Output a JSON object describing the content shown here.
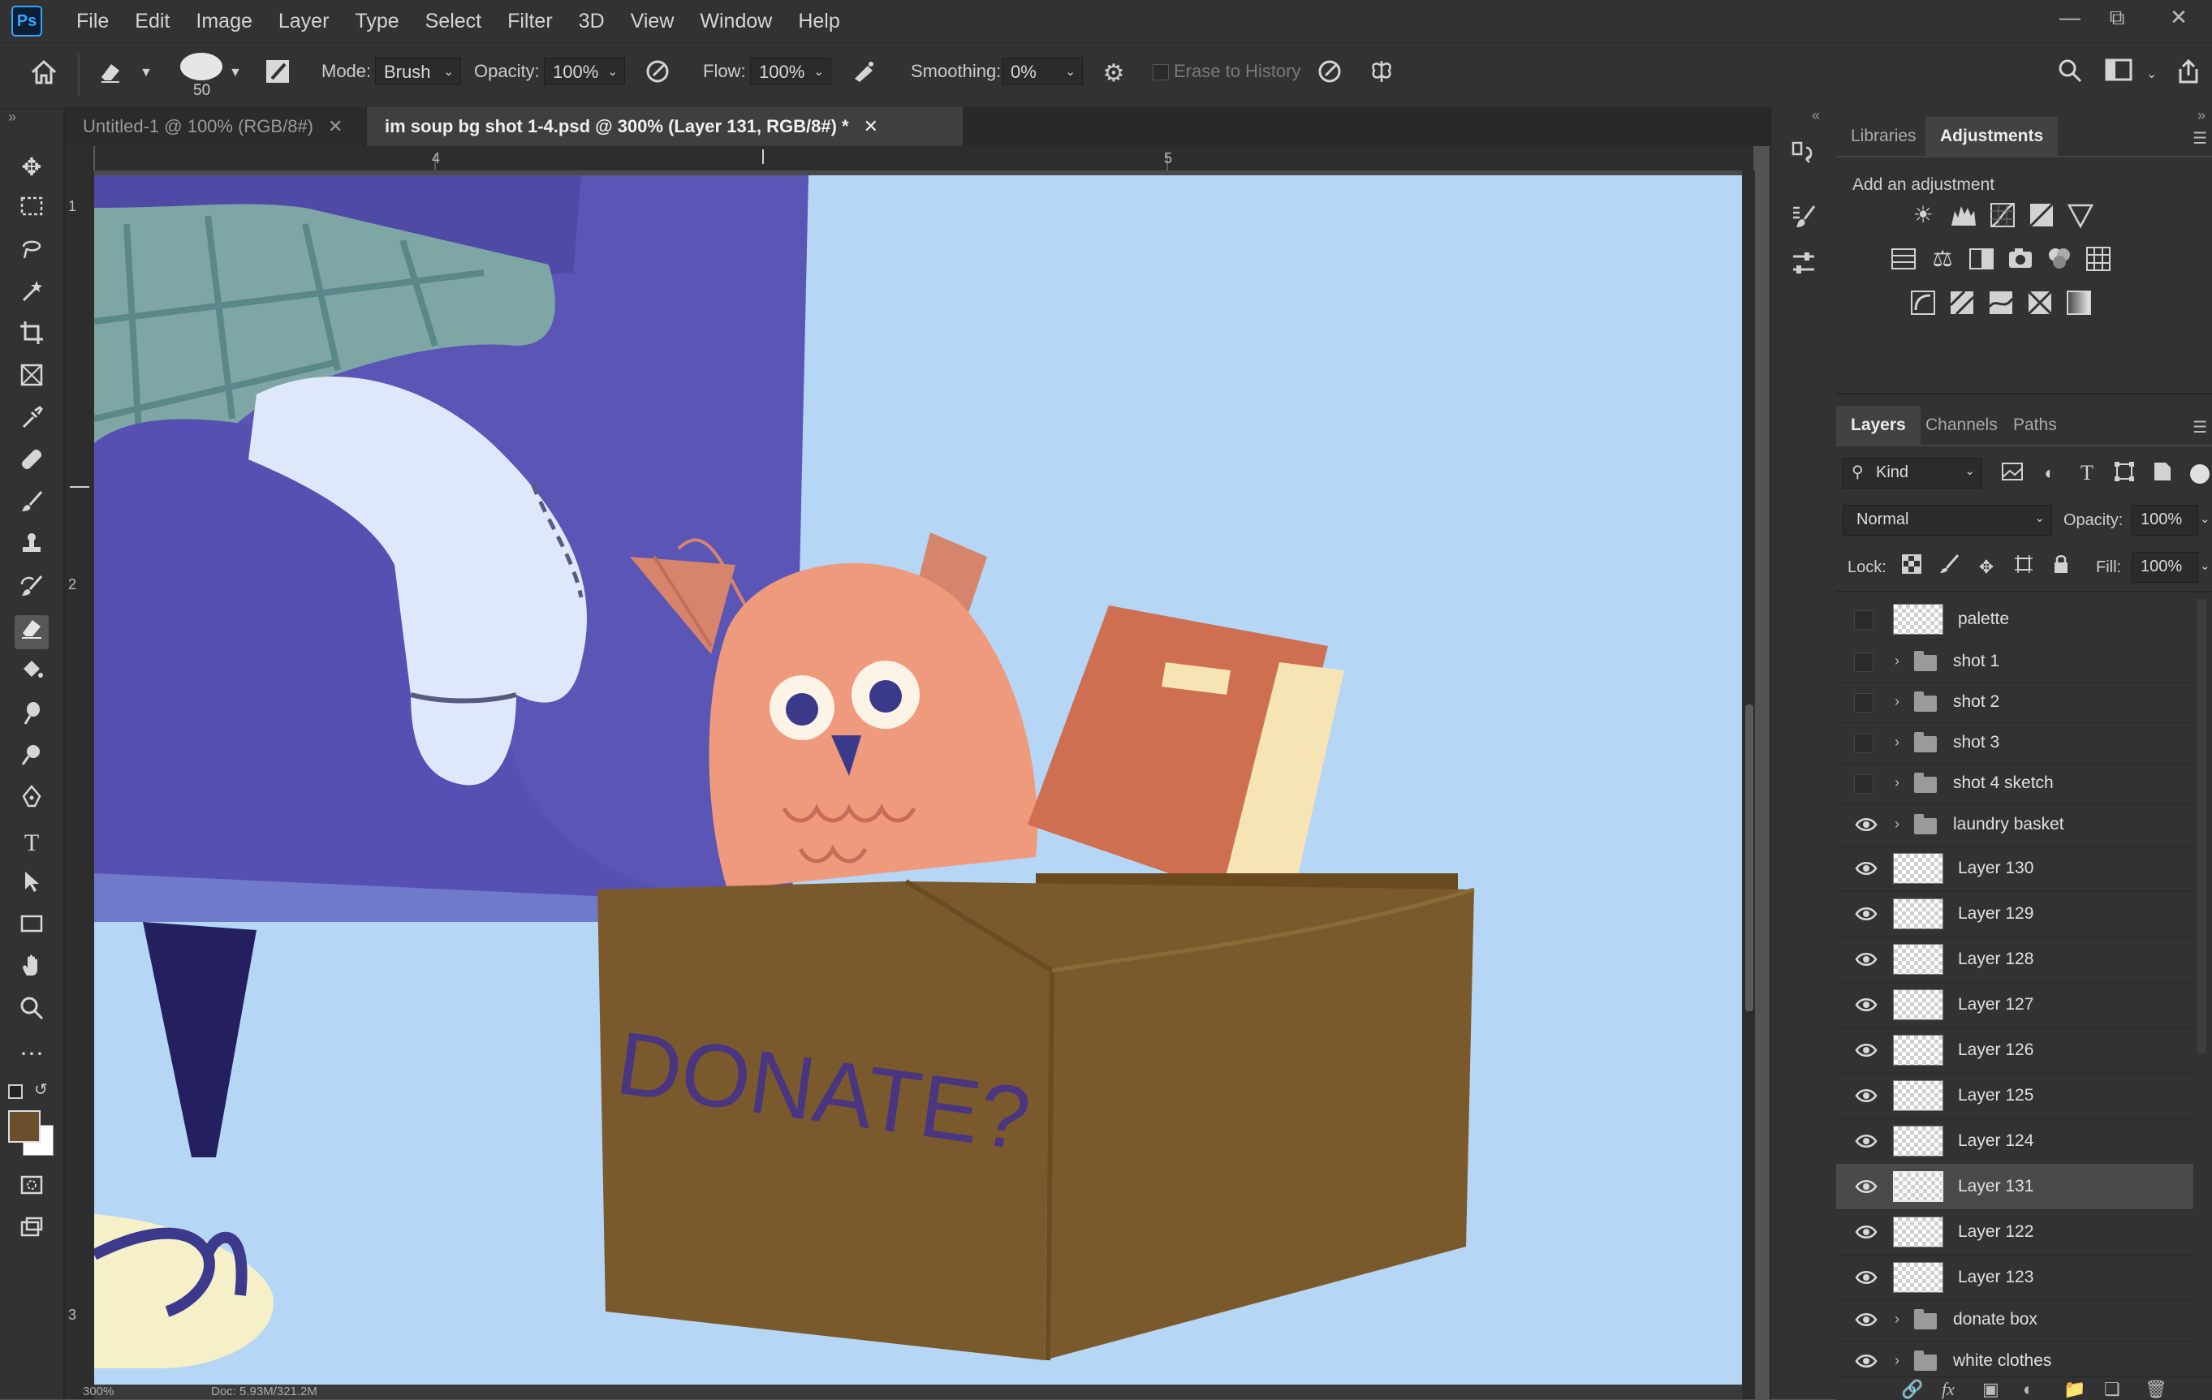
{
  "app": {
    "logo": "Ps",
    "menu": [
      "File",
      "Edit",
      "Image",
      "Layer",
      "Type",
      "Select",
      "Filter",
      "3D",
      "View",
      "Window",
      "Help"
    ]
  },
  "options": {
    "brush_size": "50",
    "mode_label": "Mode:",
    "mode_value": "Brush",
    "opacity_label": "Opacity:",
    "opacity_value": "100%",
    "flow_label": "Flow:",
    "flow_value": "100%",
    "smoothing_label": "Smoothing:",
    "smoothing_value": "0%",
    "erase_history_label": "Erase to History"
  },
  "tabs": [
    {
      "label": "Untitled-1 @ 100% (RGB/8#)",
      "active": false
    },
    {
      "label": "im soup bg shot 1-4.psd @ 300% (Layer 131, RGB/8#) *",
      "active": true
    }
  ],
  "ruler": {
    "top": [
      "4",
      "5"
    ],
    "left": [
      "1",
      "2",
      "3"
    ]
  },
  "canvas": {
    "box_text": "DONATE?"
  },
  "status": {
    "zoom": "300%",
    "doc": "Doc: 5.93M/321.2M"
  },
  "colors": {
    "foreground": "#6b4f2c",
    "background": "#ffffff",
    "accent": "#31a8ff",
    "sky": "#b5d6f5",
    "couch": "#5b56b5",
    "owl": "#ef9a7c",
    "box": "#7a5a2c"
  },
  "panels": {
    "top_tabs": [
      "Libraries",
      "Adjustments"
    ],
    "add_adjustment": "Add an adjustment",
    "layer_tabs": [
      "Layers",
      "Channels",
      "Paths"
    ],
    "kind_label": "Kind",
    "blend_mode": "Normal",
    "opacity_label": "Opacity:",
    "opacity_value": "100%",
    "lock_label": "Lock:",
    "fill_label": "Fill:",
    "fill_value": "100%"
  },
  "layers": [
    {
      "name": "palette",
      "type": "layer",
      "visible": false,
      "selected": false
    },
    {
      "name": "shot 1",
      "type": "group",
      "visible": false,
      "selected": false
    },
    {
      "name": "shot 2",
      "type": "group",
      "visible": false,
      "selected": false
    },
    {
      "name": "shot 3",
      "type": "group",
      "visible": false,
      "selected": false
    },
    {
      "name": "shot 4 sketch",
      "type": "group",
      "visible": false,
      "selected": false
    },
    {
      "name": "laundry basket",
      "type": "group",
      "visible": true,
      "selected": false
    },
    {
      "name": "Layer 130",
      "type": "layer",
      "visible": true,
      "selected": false
    },
    {
      "name": "Layer 129",
      "type": "layer",
      "visible": true,
      "selected": false
    },
    {
      "name": "Layer 128",
      "type": "layer",
      "visible": true,
      "selected": false
    },
    {
      "name": "Layer 127",
      "type": "layer",
      "visible": true,
      "selected": false
    },
    {
      "name": "Layer 126",
      "type": "layer",
      "visible": true,
      "selected": false
    },
    {
      "name": "Layer 125",
      "type": "layer",
      "visible": true,
      "selected": false
    },
    {
      "name": "Layer 124",
      "type": "layer",
      "visible": true,
      "selected": false
    },
    {
      "name": "Layer 131",
      "type": "layer",
      "visible": true,
      "selected": true
    },
    {
      "name": "Layer 122",
      "type": "layer",
      "visible": true,
      "selected": false
    },
    {
      "name": "Layer 123",
      "type": "layer",
      "visible": true,
      "selected": false
    },
    {
      "name": "donate box",
      "type": "group",
      "visible": true,
      "selected": false
    },
    {
      "name": "white clothes",
      "type": "group",
      "visible": true,
      "selected": false
    }
  ]
}
